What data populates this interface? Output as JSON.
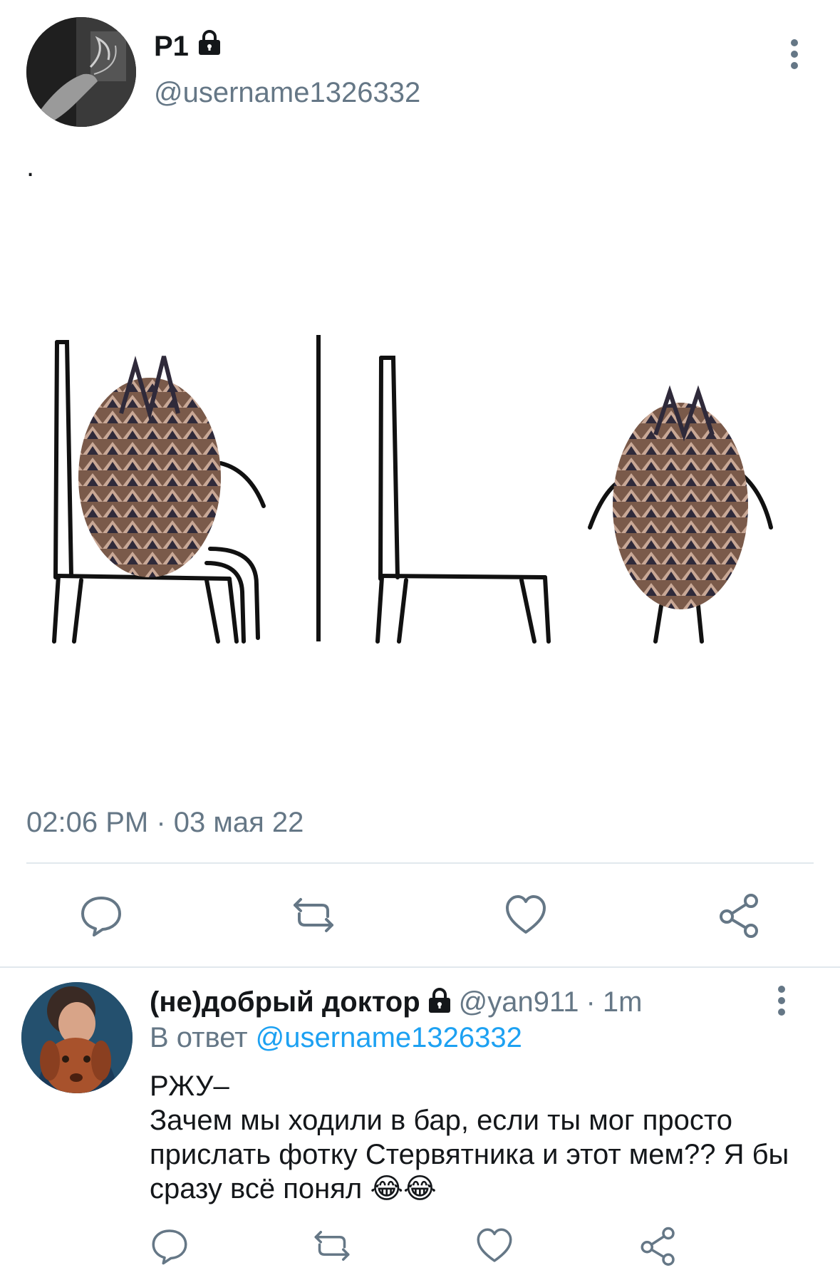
{
  "tweet": {
    "display_name": "Р1",
    "handle": "@username1326332",
    "text": ".",
    "timestamp": "02:06 PM · 03 мая 22",
    "lock_icon": "lock-icon",
    "more_icon": "more-vertical-icon"
  },
  "tweet_actions": [
    {
      "name": "reply",
      "icon": "reply-icon"
    },
    {
      "name": "retweet",
      "icon": "retweet-icon"
    },
    {
      "name": "like",
      "icon": "heart-icon"
    },
    {
      "name": "share",
      "icon": "share-icon"
    }
  ],
  "reply": {
    "display_name": "(не)добрый доктор",
    "handle": "@yan911",
    "separator": "·",
    "time": "1m",
    "reply_prefix": "В ответ",
    "reply_mention": "@username1326332",
    "text_line1": "РЖУ–",
    "text_line2": "Зачем мы ходили в бар, если ты мог просто прислать фотку Стервятника и этот мем?? Я бы сразу всё понял 😂😂"
  },
  "colors": {
    "primary_text": "#14171a",
    "secondary_text": "#657786",
    "accent": "#1da1f2",
    "divider": "#e1e8ed"
  }
}
